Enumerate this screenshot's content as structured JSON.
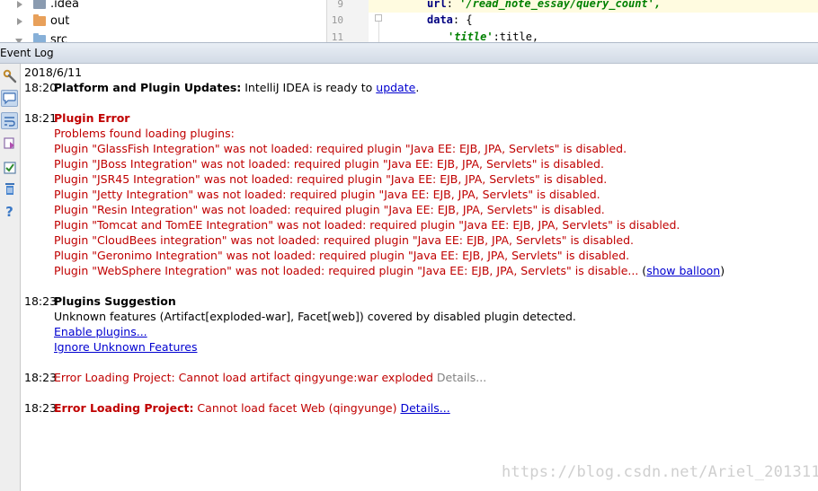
{
  "tree": {
    "items": [
      {
        "label": ".idea",
        "color": "#8a9bb0"
      },
      {
        "label": "out",
        "color": "#e8a05a"
      },
      {
        "label": "src",
        "color": "#87b0d8"
      }
    ]
  },
  "editor": {
    "line_numbers": [
      "9",
      "10",
      "11"
    ],
    "line1_key": "url",
    "line1_value": "'/read_note_essay/query_count',",
    "line2_key": "data",
    "line2_rest": ": {",
    "line3_key": "'title'",
    "line3_rest": ":title,"
  },
  "panel": {
    "title": "Event Log"
  },
  "log": {
    "date": "2018/6/11",
    "entries": {
      "e1": {
        "time": "18:20",
        "title": "Platform and Plugin Updates:",
        "text": " IntelliJ IDEA is ready to ",
        "link": "update",
        "tail": "."
      },
      "e2": {
        "time": "18:21",
        "title": "Plugin Error",
        "lines": [
          "Problems found loading plugins:",
          "Plugin \"GlassFish Integration\" was not loaded: required plugin \"Java EE: EJB, JPA, Servlets\" is disabled.",
          "Plugin \"JBoss Integration\" was not loaded: required plugin \"Java EE: EJB, JPA, Servlets\" is disabled.",
          "Plugin \"JSR45 Integration\" was not loaded: required plugin \"Java EE: EJB, JPA, Servlets\" is disabled.",
          "Plugin \"Jetty Integration\" was not loaded: required plugin \"Java EE: EJB, JPA, Servlets\" is disabled.",
          "Plugin \"Resin Integration\" was not loaded: required plugin \"Java EE: EJB, JPA, Servlets\" is disabled.",
          "Plugin \"Tomcat and TomEE Integration\" was not loaded: required plugin \"Java EE: EJB, JPA, Servlets\" is disabled.",
          "Plugin \"CloudBees integration\" was not loaded: required plugin \"Java EE: EJB, JPA, Servlets\" is disabled.",
          "Plugin \"Geronimo Integration\" was not loaded: required plugin \"Java EE: EJB, JPA, Servlets\" is disabled."
        ],
        "last_line": "Plugin \"WebSphere Integration\" was not loaded: required plugin \"Java EE: EJB, JPA, Servlets\" is disable...",
        "paren_open": " (",
        "show_balloon": "show balloon",
        "paren_close": ")"
      },
      "e3": {
        "time": "18:23",
        "title": "Plugins Suggestion",
        "text": "Unknown features (Artifact[exploded-war], Facet[web]) covered by disabled plugin detected.",
        "link1": "Enable plugins...",
        "link2": "Ignore Unknown Features"
      },
      "e4": {
        "time": "18:23",
        "text": "Error Loading Project: Cannot load artifact qingyunge:war exploded",
        "details": " Details..."
      },
      "e5": {
        "time": "18:23",
        "title": "Error Loading Project:",
        "text": " Cannot load facet Web (qingyunge) ",
        "details": "Details..."
      }
    }
  },
  "watermark": "https://blog.csdn.net/Ariel_201311",
  "colors": {
    "error": "#c00000",
    "link": "#0000d0",
    "selected_tool": "#c5d8ee"
  }
}
